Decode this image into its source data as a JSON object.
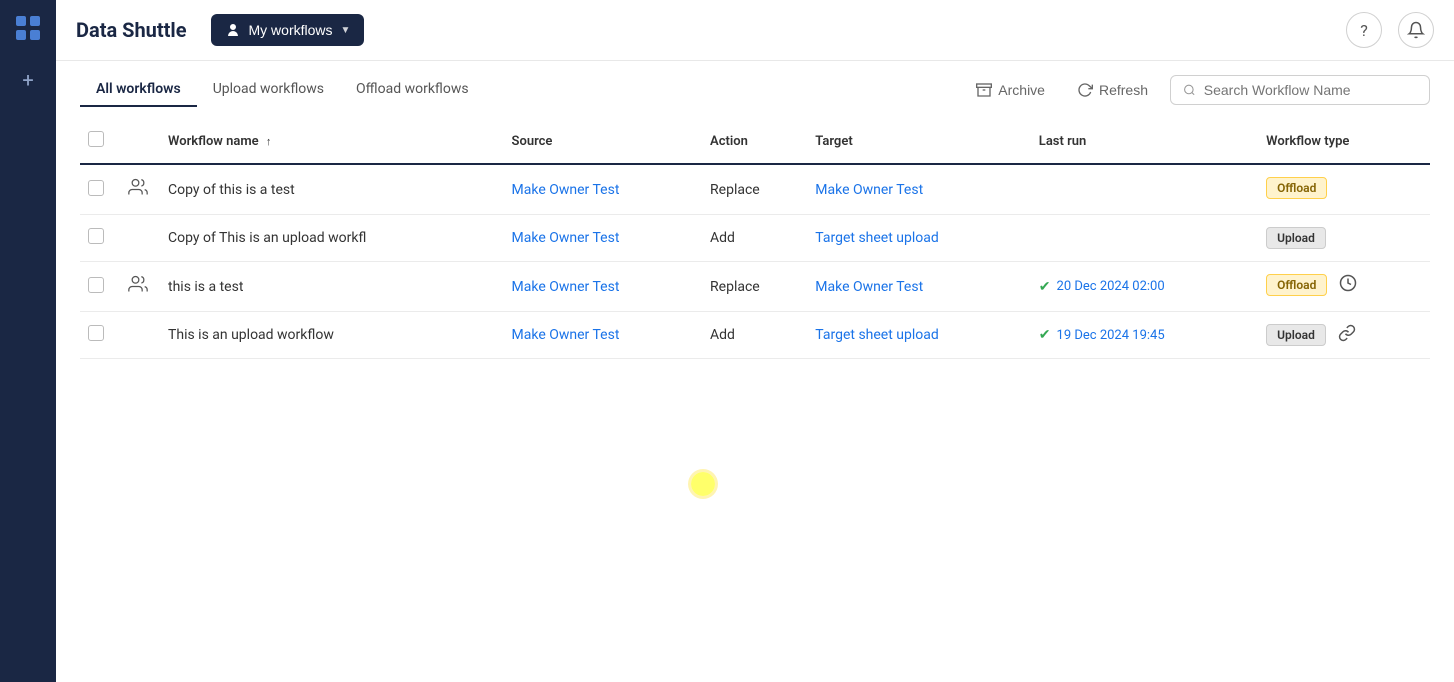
{
  "app": {
    "title": "Data Shuttle",
    "sidebar": {
      "logo_icon": "grid-icon",
      "add_icon": "plus-icon"
    }
  },
  "header": {
    "title": "Data Shuttle",
    "my_workflows_label": "My workflows",
    "help_icon": "help-circle-icon",
    "notification_icon": "bell-icon"
  },
  "toolbar": {
    "tabs": [
      {
        "id": "all",
        "label": "All workflows",
        "active": true
      },
      {
        "id": "upload",
        "label": "Upload workflows",
        "active": false
      },
      {
        "id": "offload",
        "label": "Offload workflows",
        "active": false
      }
    ],
    "archive_label": "Archive",
    "refresh_label": "Refresh",
    "search_placeholder": "Search Workflow Name"
  },
  "table": {
    "columns": [
      {
        "id": "checkbox",
        "label": ""
      },
      {
        "id": "icon",
        "label": ""
      },
      {
        "id": "name",
        "label": "Workflow name",
        "sortable": true,
        "sort_dir": "asc"
      },
      {
        "id": "source",
        "label": "Source"
      },
      {
        "id": "action",
        "label": "Action"
      },
      {
        "id": "target",
        "label": "Target"
      },
      {
        "id": "last_run",
        "label": "Last run"
      },
      {
        "id": "type",
        "label": "Workflow type"
      }
    ],
    "rows": [
      {
        "id": 1,
        "checked": false,
        "has_shared_icon": true,
        "name": "Copy of this is a test",
        "source": "Make Owner Test",
        "source_link": true,
        "action": "Replace",
        "target": "Make Owner Test",
        "target_link": true,
        "last_run": null,
        "workflow_type": "Offload",
        "type_class": "offload",
        "row_icon": null
      },
      {
        "id": 2,
        "checked": false,
        "has_shared_icon": false,
        "name": "Copy of This is an upload workfl",
        "source": "Make Owner Test",
        "source_link": true,
        "action": "Add",
        "target": "Target sheet upload",
        "target_link": true,
        "last_run": null,
        "workflow_type": "Upload",
        "type_class": "upload",
        "row_icon": null
      },
      {
        "id": 3,
        "checked": false,
        "has_shared_icon": true,
        "name": "this is a test",
        "source": "Make Owner Test",
        "source_link": true,
        "action": "Replace",
        "target": "Make Owner Test",
        "target_link": true,
        "last_run": "20 Dec 2024 02:00",
        "last_run_success": true,
        "workflow_type": "Offload",
        "type_class": "offload",
        "row_icon": "clock-icon"
      },
      {
        "id": 4,
        "checked": false,
        "has_shared_icon": false,
        "name": "This is an upload workflow",
        "source": "Make Owner Test",
        "source_link": true,
        "action": "Add",
        "target": "Target sheet upload",
        "target_link": true,
        "last_run": "19 Dec 2024 19:45",
        "last_run_success": true,
        "workflow_type": "Upload",
        "type_class": "upload",
        "row_icon": "link-icon"
      }
    ]
  },
  "colors": {
    "sidebar_bg": "#1a2744",
    "accent_blue": "#1a73e8",
    "offload_badge_bg": "#fff3cd",
    "upload_badge_bg": "#e8e8e8",
    "success_green": "#34a853"
  }
}
